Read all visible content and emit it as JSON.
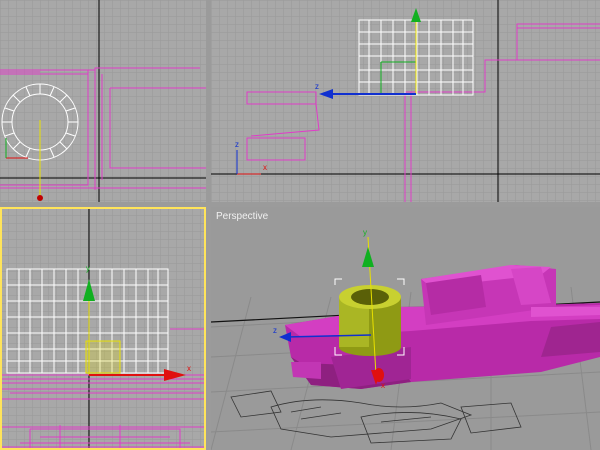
{
  "viewports": {
    "top_left": {
      "name": "top-left-viewport"
    },
    "top_right": {
      "name": "top-right-viewport"
    },
    "bottom_left": {
      "name": "bottom-left-viewport",
      "active": true
    },
    "perspective": {
      "label": "Perspective"
    }
  },
  "axes": {
    "x": "x",
    "y": "y",
    "z": "z"
  },
  "colors": {
    "grid_bg": "#a9a9a9",
    "grid_line": "#9a9a9a",
    "grid_major": "#000000",
    "wire_pink": "#e03cc8",
    "wire_white": "#ffffff",
    "active_border": "#ffe45a",
    "axis_x": "#e01010",
    "axis_y": "#10b020",
    "axis_z": "#1030d0",
    "boat_magenta": "#c030b0",
    "cylinder_olive": "#a8b420"
  }
}
